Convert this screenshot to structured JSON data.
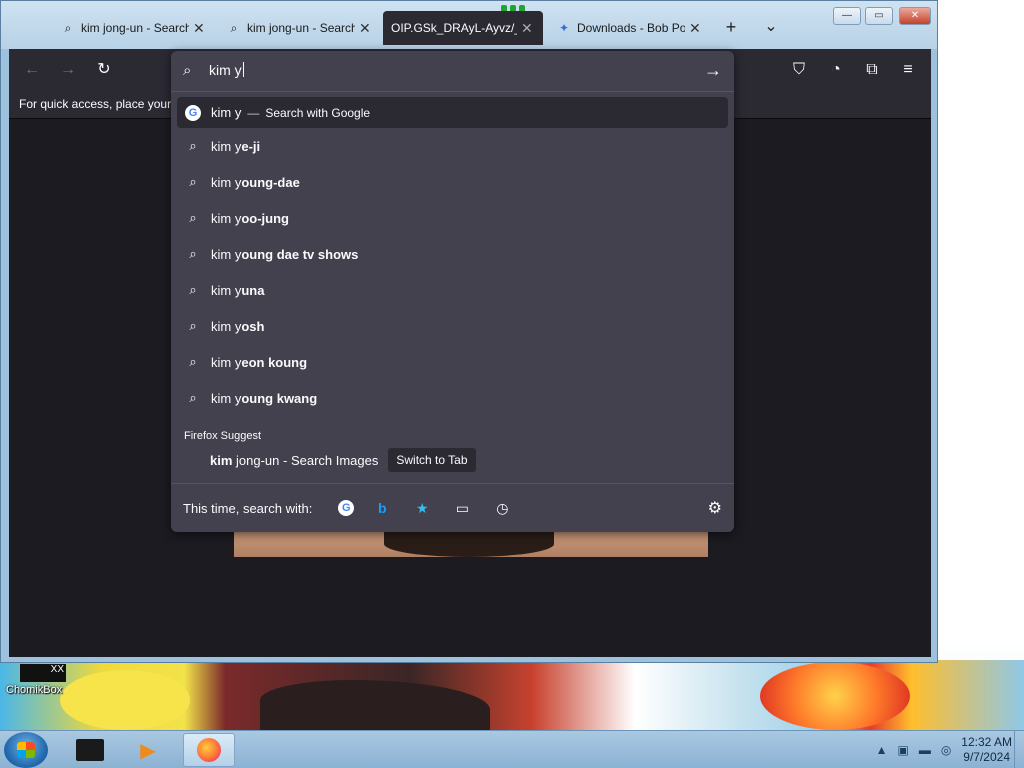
{
  "window": {
    "tabs": [
      {
        "icon": "search-icon",
        "label": "kim jong-un - Search"
      },
      {
        "icon": "search-icon",
        "label": "kim jong-un - Search"
      },
      {
        "icon": "",
        "label": "OIP.GSk_DRAyL-Ayvz/_"
      },
      {
        "icon": "puzzle-icon",
        "label": "Downloads - Bob Po"
      }
    ],
    "new_tab_symbol": "+",
    "tab_list_symbol": "⌄",
    "controls": {
      "minimize": "—",
      "maximize": "▭",
      "close": "✕"
    }
  },
  "toolbar": {
    "back_symbol": "←",
    "forward_symbol": "→",
    "reload_symbol": "↻",
    "pocket_symbol": "⛉",
    "account_symbol": "◔",
    "extensions_symbol": "⧉",
    "menu_symbol": "≡"
  },
  "bookmarks_bar": {
    "text": "For quick access, place your b"
  },
  "urlbar": {
    "input_value": "kim y",
    "go_symbol": "→",
    "first_result": {
      "query": "kim y",
      "separator": "—",
      "action": "Search with Google"
    },
    "suggestions": [
      {
        "prefix": "kim y",
        "rest": "e-ji"
      },
      {
        "prefix": "kim y",
        "rest": "oung-dae"
      },
      {
        "prefix": "kim y",
        "rest": "oo-jung"
      },
      {
        "prefix": "kim y",
        "rest": "oung dae tv shows"
      },
      {
        "prefix": "kim y",
        "rest": "una"
      },
      {
        "prefix": "kim y",
        "rest": "osh"
      },
      {
        "prefix": "kim y",
        "rest": "eon koung"
      },
      {
        "prefix": "kim y",
        "rest": "oung kwang"
      }
    ],
    "firefox_suggest_label": "Firefox Suggest",
    "tab_result": {
      "bold": "kim",
      "rest": " jong-un - Search Images",
      "chip": "Switch to Tab"
    },
    "engines_label": "This time, search with:",
    "engines": [
      "google",
      "bing",
      "bookmarks",
      "tabs",
      "history"
    ]
  },
  "desktop": {
    "icon_label": "ChomikBox",
    "icon_badge": "XX"
  },
  "taskbar": {
    "time": "12:32 AM",
    "date": "9/7/2024"
  }
}
